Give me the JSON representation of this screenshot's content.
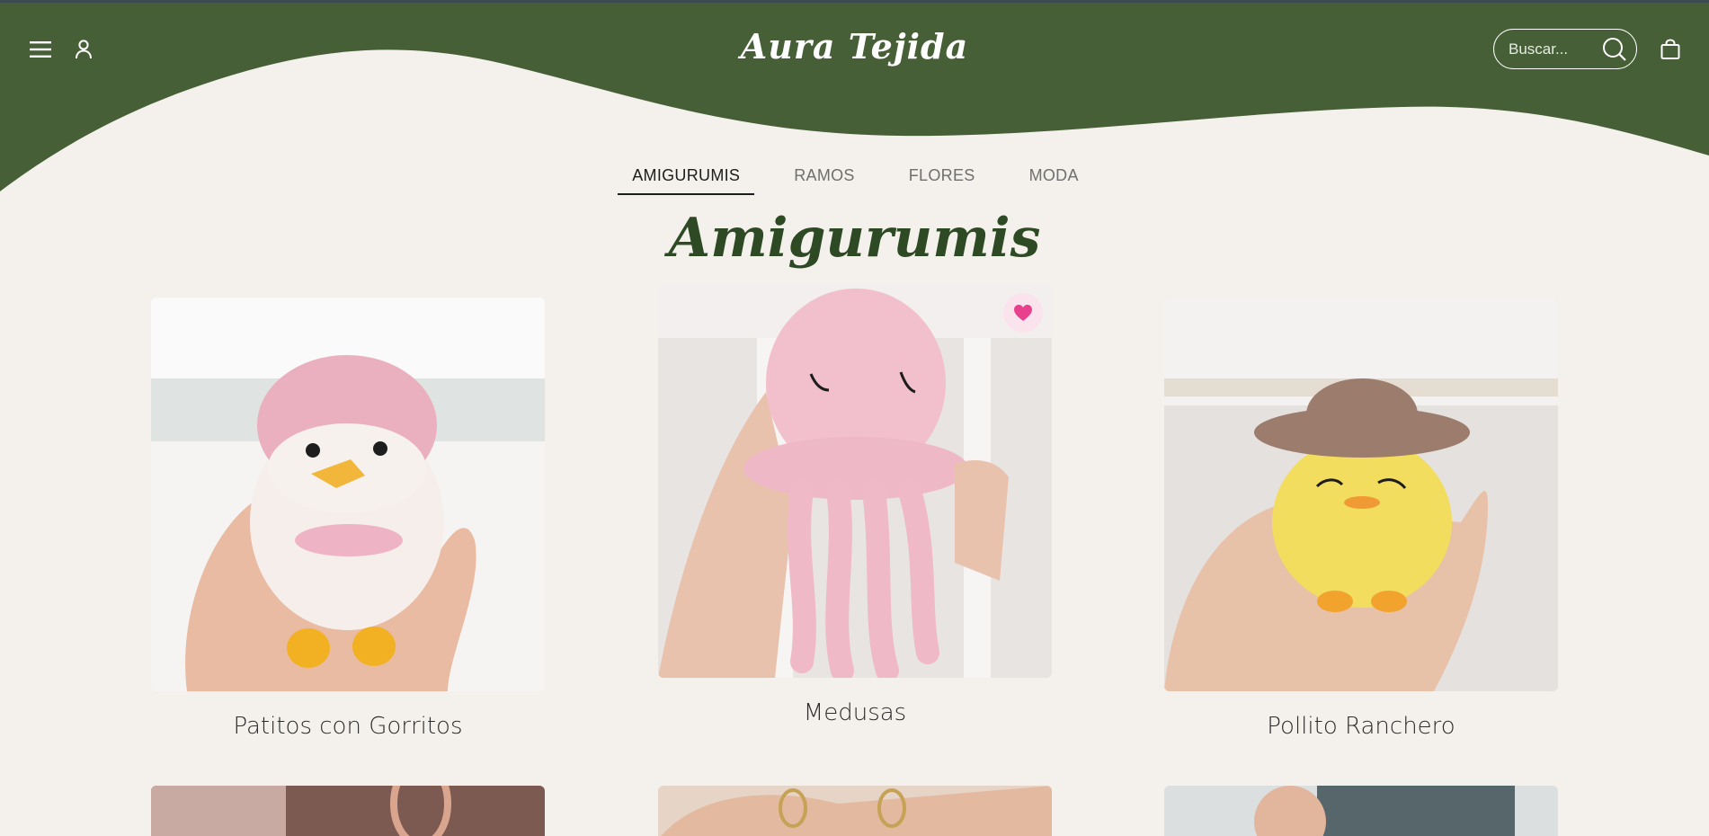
{
  "brand": {
    "name": "Aura Tejida"
  },
  "colors": {
    "header_green": "#465f37",
    "background": "#f4f1ec",
    "title_green": "#2e4a24",
    "favorite_pink": "#e8408c"
  },
  "header": {
    "menu_icon": "hamburger-menu-icon",
    "account_icon": "user-icon",
    "search_placeholder": "Buscar...",
    "search_icon": "search-icon",
    "cart_icon": "shopping-bag-icon"
  },
  "tabs": [
    {
      "label": "AMIGURUMIS",
      "active": true
    },
    {
      "label": "RAMOS",
      "active": false
    },
    {
      "label": "FLORES",
      "active": false
    },
    {
      "label": "MODA",
      "active": false
    }
  ],
  "section": {
    "title": "Amigurumis"
  },
  "products": [
    {
      "name": "Patitos con Gorritos",
      "favorite": false
    },
    {
      "name": "Medusas",
      "favorite": true
    },
    {
      "name": "Pollito Ranchero",
      "favorite": false
    }
  ]
}
